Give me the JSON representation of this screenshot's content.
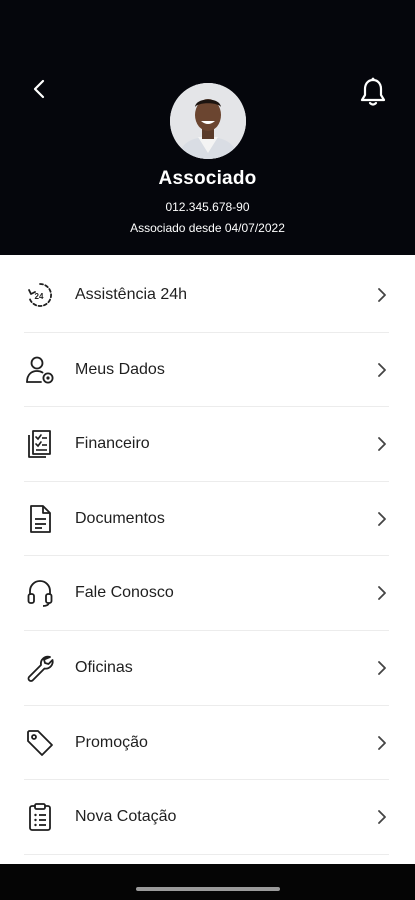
{
  "header": {
    "name": "Associado",
    "cpf": "012.345.678-90",
    "member_since": "Associado desde 04/07/2022",
    "back_icon": "chevron-left-icon",
    "bell_icon": "bell-icon",
    "background": "#05060c"
  },
  "menu": [
    {
      "label": "Assistência 24h",
      "icon": "clock-24h-icon"
    },
    {
      "label": "Meus Dados",
      "icon": "user-settings-icon"
    },
    {
      "label": "Financeiro",
      "icon": "checklist-icon"
    },
    {
      "label": "Documentos",
      "icon": "document-icon"
    },
    {
      "label": "Fale Conosco",
      "icon": "headset-icon"
    },
    {
      "label": "Oficinas",
      "icon": "wrench-icon"
    },
    {
      "label": "Promoção",
      "icon": "tag-icon"
    },
    {
      "label": "Nova Cotação",
      "icon": "clipboard-list-icon"
    }
  ]
}
